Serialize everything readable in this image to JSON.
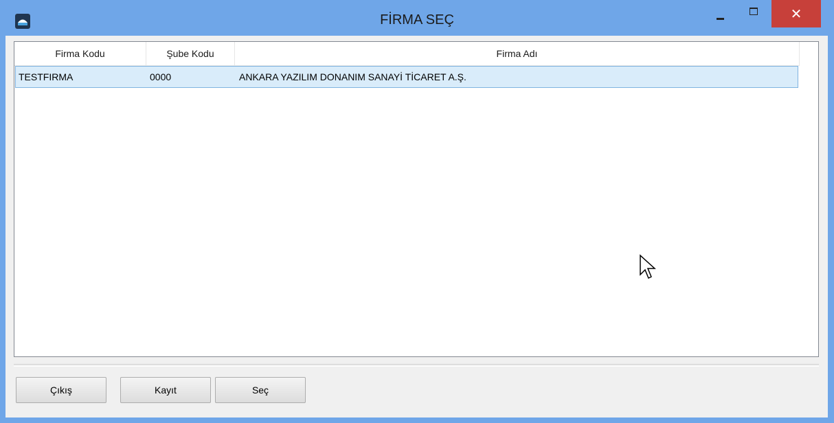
{
  "window": {
    "title": "FİRMA SEÇ",
    "close_glyph": "✕"
  },
  "grid": {
    "columns": [
      "Firma Kodu",
      "Şube Kodu",
      "Firma Adı"
    ],
    "rows": [
      [
        "TESTFIRMA",
        "0000",
        "ANKARA YAZILIM DONANIM SANAYİ TİCARET A.Ş."
      ]
    ],
    "selected_row": 0
  },
  "buttons": {
    "exit": "Çıkış",
    "record": "Kayıt",
    "select": "Seç"
  },
  "colors": {
    "title_bar": "#6fa6e8",
    "close_button": "#c7403a",
    "selected_row": "#d9ecfa"
  },
  "icons": {
    "app": "app-icon",
    "minimize": "minimize-icon",
    "maximize": "maximize-icon",
    "close": "close-icon",
    "cursor": "mouse-cursor-icon"
  }
}
